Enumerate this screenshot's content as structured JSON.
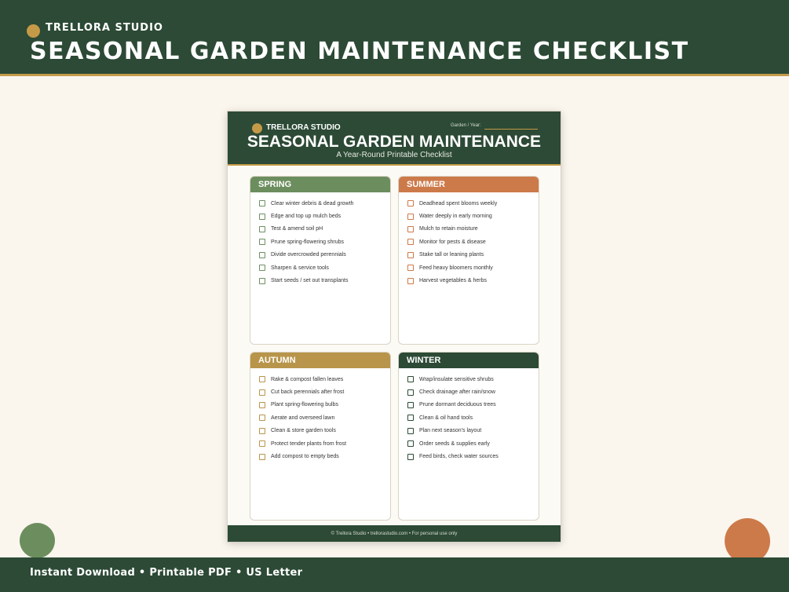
{
  "banner": {
    "brand": "TRELLORA STUDIO",
    "title": "SEASONAL GARDEN MAINTENANCE CHECKLIST"
  },
  "paper": {
    "brand": "TRELLORA STUDIO",
    "garden_year_label": "Garden / Year:",
    "title": "SEASONAL GARDEN MAINTENANCE",
    "subtitle": "A Year-Round Printable Checklist",
    "footer": "© Trellora Studio  •  trellorastudio.com  •  For personal use only"
  },
  "seasons": [
    {
      "name": "SPRING",
      "items": [
        "Clear winter debris & dead growth",
        "Edge and top up mulch beds",
        "Test & amend soil pH",
        "Prune spring-flowering shrubs",
        "Divide overcrowded perennials",
        "Sharpen & service tools",
        "Start seeds / set out transplants"
      ]
    },
    {
      "name": "SUMMER",
      "items": [
        "Deadhead spent blooms weekly",
        "Water deeply in early morning",
        "Mulch to retain moisture",
        "Monitor for pests & disease",
        "Stake tall or leaning plants",
        "Feed heavy bloomers monthly",
        "Harvest vegetables & herbs"
      ]
    },
    {
      "name": "AUTUMN",
      "items": [
        "Rake & compost fallen leaves",
        "Cut back perennials after frost",
        "Plant spring-flowering bulbs",
        "Aerate and overseed lawn",
        "Clean & store garden tools",
        "Protect tender plants from frost",
        "Add compost to empty beds"
      ]
    },
    {
      "name": "WINTER",
      "items": [
        "Wrap/insulate sensitive shrubs",
        "Check drainage after rain/snow",
        "Prune dormant deciduous trees",
        "Clean & oil hand tools",
        "Plan next season's layout",
        "Order seeds & supplies early",
        "Feed birds, check water sources"
      ]
    }
  ],
  "footer": {
    "text": "Instant Download  •  Printable PDF  •  US Letter"
  },
  "colors": {
    "forest_green": "#2c4a35",
    "gold": "#c49a48",
    "sage": "#6c8e5e",
    "terracotta": "#cd7a4a",
    "ochre": "#b8954a",
    "cream": "#faf6ee"
  }
}
